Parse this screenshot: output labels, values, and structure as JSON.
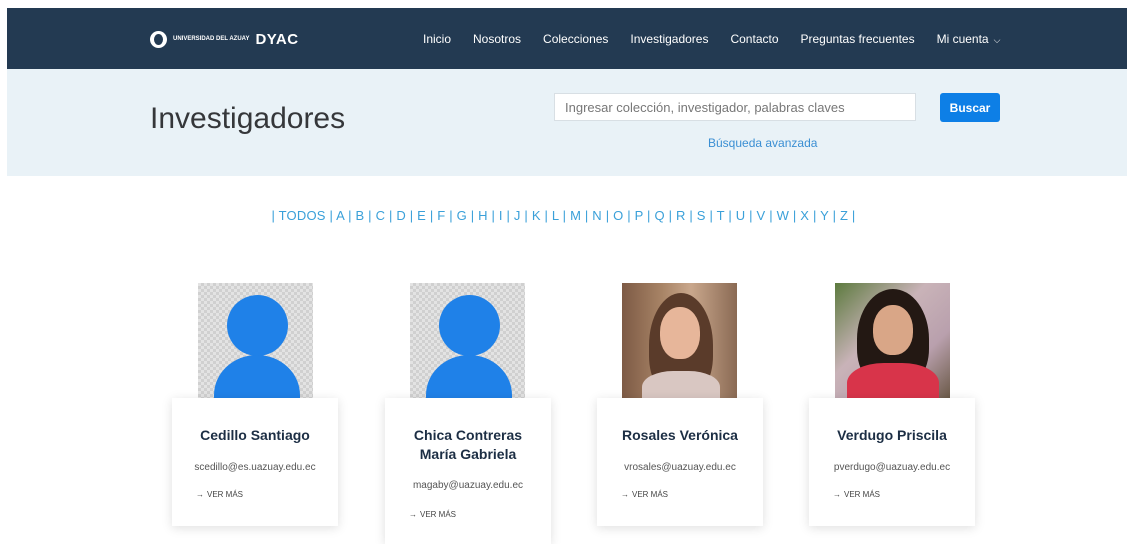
{
  "brand": {
    "logo_small": "UNIVERSIDAD DEL AZUAY",
    "logo_main": "DYAC"
  },
  "nav": {
    "items": [
      "Inicio",
      "Nosotros",
      "Colecciones",
      "Investigadores",
      "Contacto",
      "Preguntas frecuentes"
    ],
    "account_label": "Mi cuenta"
  },
  "hero": {
    "title": "Investigadores",
    "search_placeholder": "Ingresar colección, investigador, palabras claves",
    "search_button": "Buscar",
    "advanced_link": "Búsqueda avanzada"
  },
  "alphabet": [
    "TODOS",
    "A",
    "B",
    "C",
    "D",
    "E",
    "F",
    "G",
    "H",
    "I",
    "J",
    "K",
    "L",
    "M",
    "N",
    "O",
    "P",
    "Q",
    "R",
    "S",
    "T",
    "U",
    "V",
    "W",
    "X",
    "Y",
    "Z"
  ],
  "researchers": [
    {
      "name": "Cedillo Santiago",
      "email": "scedillo@es.uazuay.edu.ec",
      "more": "VER MÁS",
      "photo": "placeholder-avatar"
    },
    {
      "name": "Chica Contreras María Gabriela",
      "email": "magaby@uazuay.edu.ec",
      "more": "VER MÁS",
      "photo": "placeholder-avatar"
    },
    {
      "name": "Rosales Verónica",
      "email": "vrosales@uazuay.edu.ec",
      "more": "VER MÁS",
      "photo": "portrait-photo"
    },
    {
      "name": "Verdugo Priscila",
      "email": "pverdugo@uazuay.edu.ec",
      "more": "VER MÁS",
      "photo": "portrait-photo"
    }
  ],
  "colors": {
    "navbar": "#233a52",
    "hero_bg": "#e9f2f7",
    "accent": "#0d7fe6",
    "link": "#3aa0d9"
  }
}
